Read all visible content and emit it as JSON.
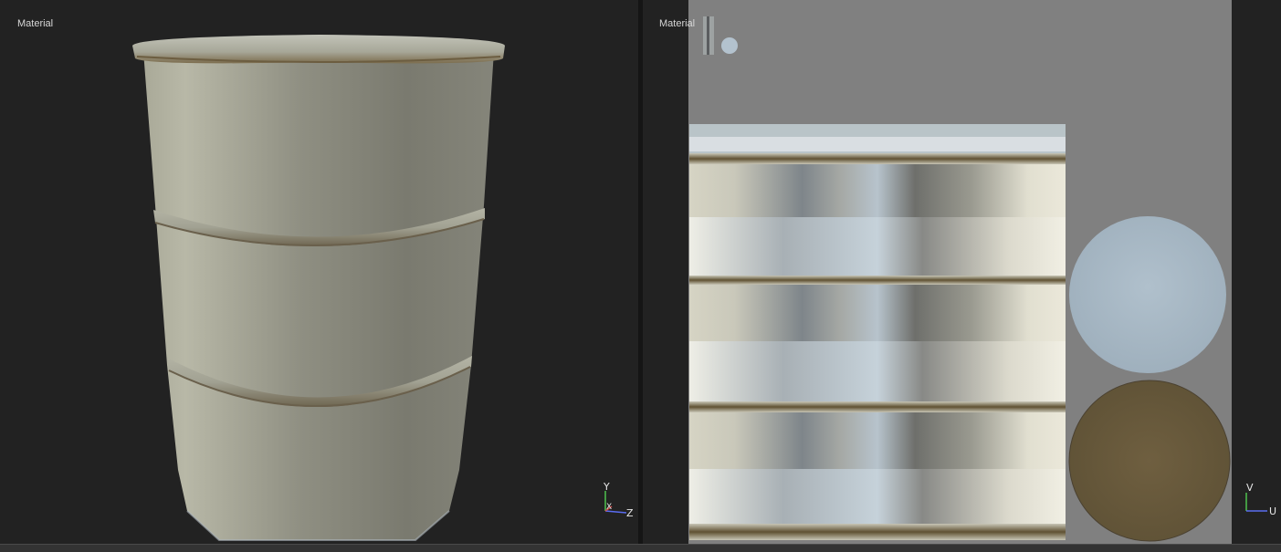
{
  "viewports": {
    "left": {
      "label": "Material",
      "axes": {
        "up": "Y",
        "side": "Z",
        "depth": "X"
      }
    },
    "right": {
      "label": "Material",
      "axes": {
        "up": "V",
        "side": "U"
      }
    }
  },
  "colors": {
    "viewport_bg": "#222222",
    "uv_bg": "#808080",
    "barrel_body": "#9b9b8c",
    "axis_green": "#4ec24e",
    "axis_blue": "#5a6cf0",
    "cap_top": "#adbcc9",
    "cap_bottom": "#6b5a3c"
  }
}
